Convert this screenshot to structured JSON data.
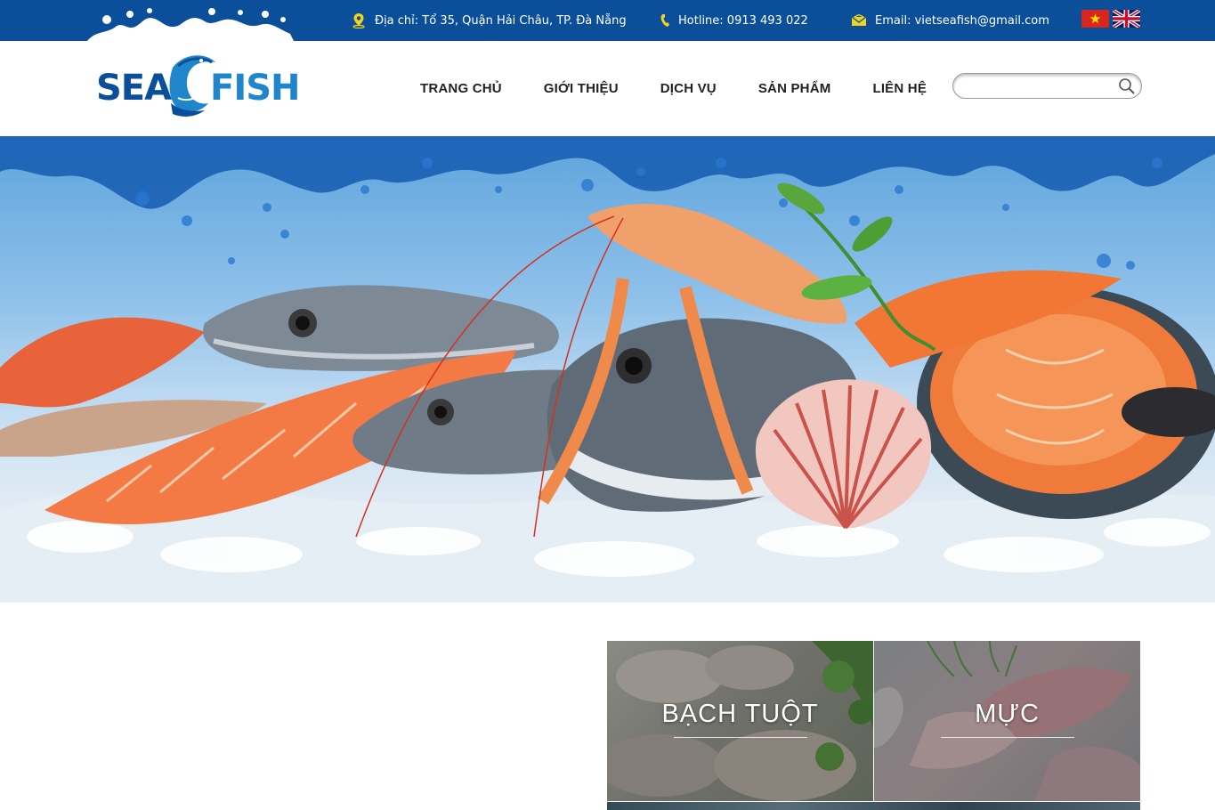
{
  "topbar": {
    "address": "Địa chỉ: Tổ 35, Quận Hải Châu, TP. Đà Nẵng",
    "hotline": "Hotline: 0913 493 022",
    "email": "Email: vietseafish@gmail.com",
    "languages": [
      "Tiếng Việt",
      "English"
    ]
  },
  "logo": {
    "part1": "SEA",
    "part2": "FISH"
  },
  "nav": {
    "items": [
      "TRANG CHỦ",
      "GIỚI THIỆU",
      "DỊCH VỤ",
      "SẢN PHẨM",
      "LIÊN HỆ"
    ]
  },
  "search": {
    "placeholder": "",
    "value": ""
  },
  "categories": [
    {
      "title": "BẠCH TUỘT"
    },
    {
      "title": "MỰC"
    }
  ],
  "colors": {
    "topbar": "#0b4f9a",
    "icon_yellow": "#f2d21b",
    "logo_dark": "#0b4f9a",
    "logo_light": "#1f86cc"
  },
  "icons": [
    "map-pin-icon",
    "phone-icon",
    "mail-icon",
    "search-icon",
    "vietnam-flag-icon",
    "uk-flag-icon"
  ]
}
